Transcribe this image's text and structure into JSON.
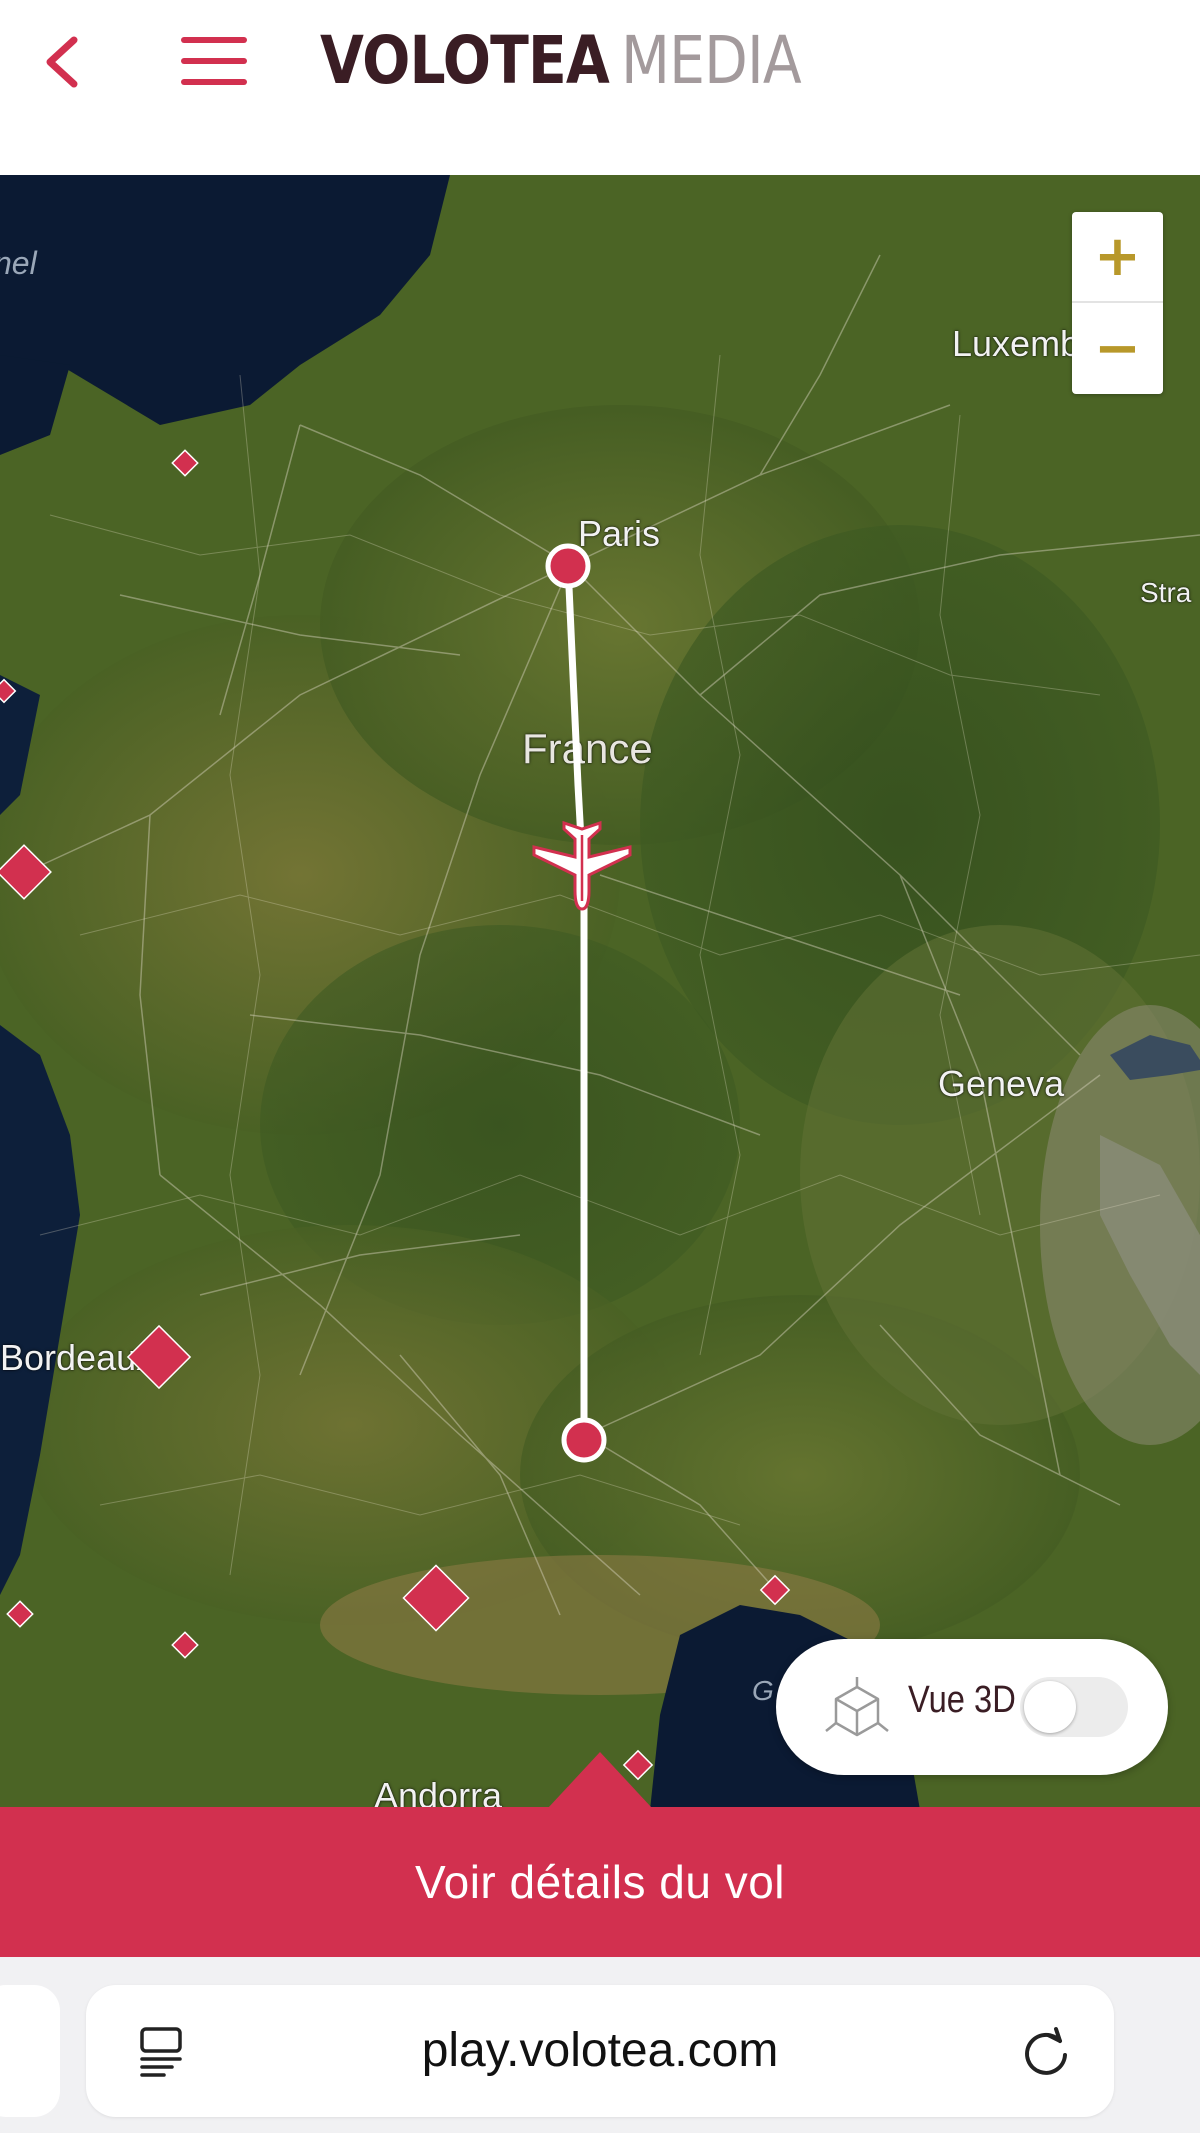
{
  "header": {
    "back_icon": "chevron-left-icon",
    "menu_icon": "hamburger-menu-icon",
    "brand_main": "VOLOTEA",
    "brand_sub": "MEDIA",
    "accent_color": "#d2304f"
  },
  "map": {
    "labels": {
      "channel": "nel",
      "paris": "Paris",
      "france": "France",
      "geneva": "Geneva",
      "bordeaux": "Bordeaux",
      "andorra": "Andorra",
      "luxembourg": "Luxembourg",
      "strasbourg": "Stra",
      "gulf": "G"
    },
    "zoom_in": "+",
    "zoom_out": "−",
    "toggle_3d_label": "Vue 3D",
    "toggle_3d_on": false,
    "route_color": "#ffffff",
    "airport_color": "#d2304f"
  },
  "flight_details": {
    "label": "Voir détails du vol"
  },
  "browser": {
    "url": "play.volotea.com",
    "reader_icon": "reader-mode-icon",
    "reload_icon": "reload-icon"
  }
}
